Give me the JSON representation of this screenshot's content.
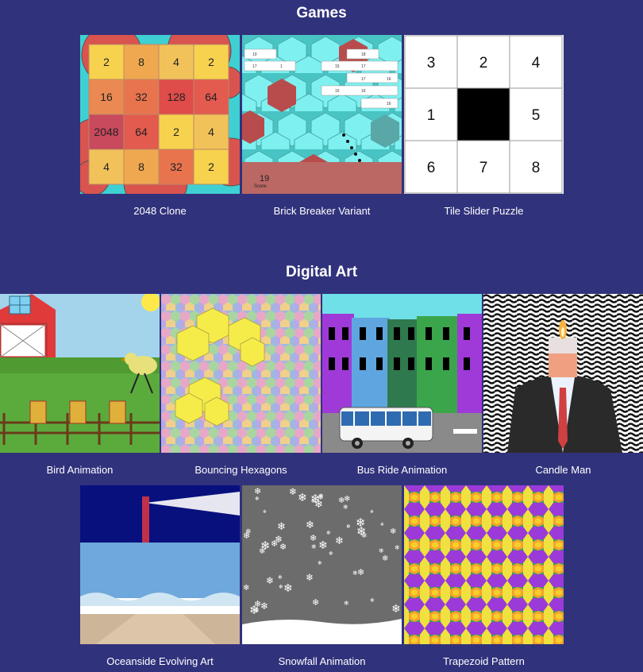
{
  "sections": {
    "games": {
      "title": "Games",
      "items": [
        {
          "name": "2048 Clone"
        },
        {
          "name": "Brick Breaker Variant"
        },
        {
          "name": "Tile Slider Puzzle"
        }
      ]
    },
    "digital_art": {
      "title": "Digital Art",
      "items": [
        {
          "name": "Bird Animation"
        },
        {
          "name": "Bouncing Hexagons"
        },
        {
          "name": "Bus Ride Animation"
        },
        {
          "name": "Candle Man"
        },
        {
          "name": "Oceanside Evolving Art"
        },
        {
          "name": "Snowfall Animation"
        },
        {
          "name": "Trapezoid Pattern"
        }
      ]
    }
  },
  "game_2048": {
    "grid": [
      [
        "2",
        "8",
        "4",
        "2"
      ],
      [
        "16",
        "32",
        "128",
        "64"
      ],
      [
        "2048",
        "64",
        "2",
        "4"
      ],
      [
        "4",
        "8",
        "32",
        "2"
      ]
    ]
  },
  "brick_breaker": {
    "score_value": "19",
    "score_label": "Score",
    "brick_numbers": [
      "19",
      "17",
      "1",
      "18",
      "15",
      "17",
      "17",
      "15",
      "16",
      "16",
      "16"
    ]
  },
  "tile_slider": {
    "tiles": [
      "3",
      "2",
      "4",
      "1",
      "",
      "5",
      "6",
      "7",
      "8"
    ]
  },
  "colors": {
    "background": "#31327c",
    "caption_text": "#ffffff"
  }
}
